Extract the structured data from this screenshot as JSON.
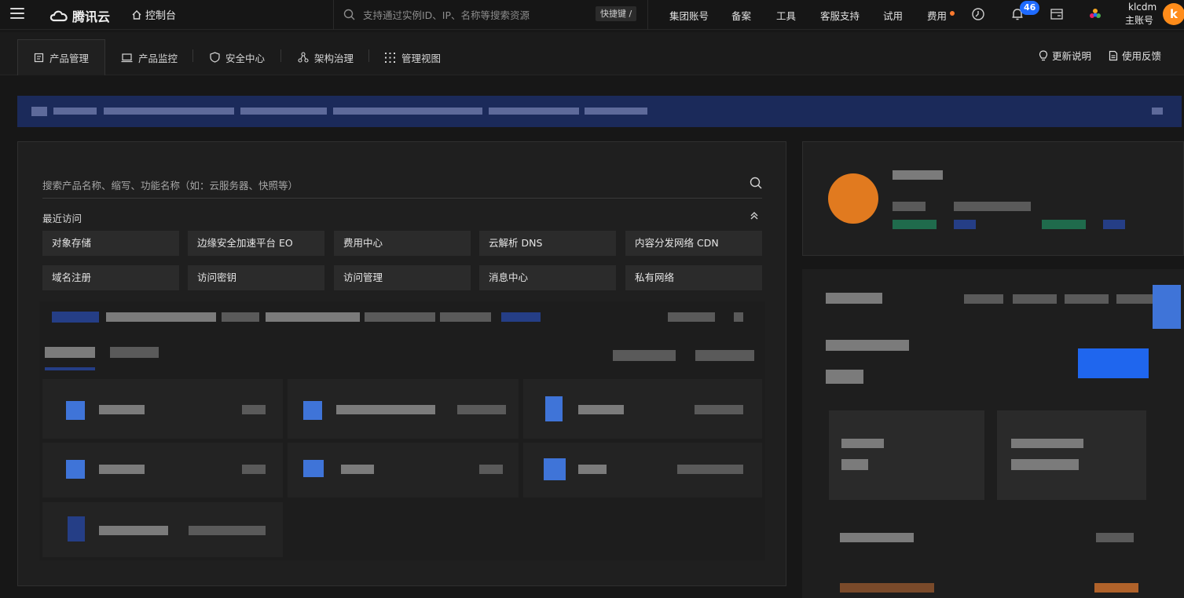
{
  "topbar": {
    "brand": "腾讯云",
    "console": "控制台",
    "search_placeholder": "支持通过实例ID、IP、名称等搜索资源",
    "shortcut": "快捷键 /",
    "nav": [
      "集团账号",
      "备案",
      "工具",
      "客服支持",
      "试用",
      "费用"
    ],
    "notification_count": "46",
    "user_name": "klcdm",
    "user_role": "主账号",
    "avatar_letter": "k"
  },
  "tabs": {
    "items": [
      "产品管理",
      "产品监控",
      "安全中心",
      "架构治理",
      "管理视图"
    ],
    "active": "产品管理",
    "right": [
      "更新说明",
      "使用反馈"
    ]
  },
  "products": {
    "search_placeholder": "搜索产品名称、缩写、功能名称（如：云服务器、快照等）",
    "recent_title": "最近访问",
    "recent": [
      "对象存储",
      "边缘安全加速平台 EO",
      "费用中心",
      "云解析 DNS",
      "内容分发网络 CDN",
      "域名注册",
      "访问密钥",
      "访问管理",
      "消息中心",
      "私有网络"
    ]
  },
  "colors": {
    "background": "#171717",
    "card": "#1f1f1f",
    "accent_blue": "#1f66ee",
    "badge_blue": "#1f6bff",
    "avatar_orange": "#ff8c1a",
    "announcement": "#1b2a5a"
  },
  "icons": [
    "menu-icon",
    "cloud-logo-icon",
    "home-icon",
    "search-icon",
    "bell-icon",
    "clock-icon",
    "card-icon",
    "colorful-app-icon",
    "bulb-icon",
    "feedback-icon",
    "chevron-up-double-icon"
  ]
}
